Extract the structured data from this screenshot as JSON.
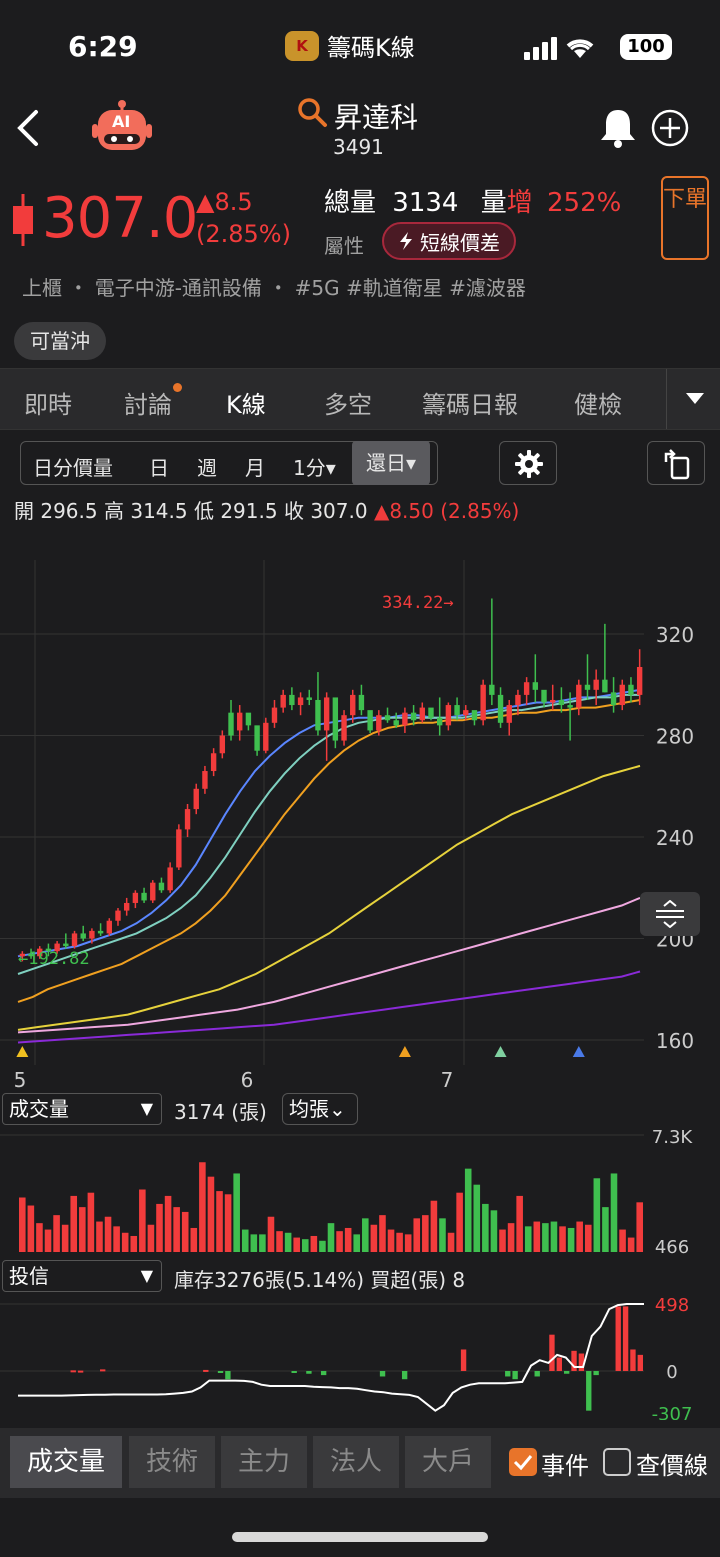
{
  "status": {
    "time": "6:29",
    "app_name": "籌碼K線",
    "app_badge": "K",
    "battery": "100"
  },
  "header": {
    "ai_label": "AI",
    "stock_name": "昇達科",
    "stock_code": "3491"
  },
  "quote": {
    "price": "307.0",
    "change": "▲8.5",
    "change_pct": "(2.85%)",
    "volume_label": "總量",
    "volume": "3134",
    "ratio_label": "量",
    "ratio_word": "增",
    "ratio": "252%",
    "attr_label": "屬性",
    "attr_tag": "短線價差",
    "order_btn": "下單",
    "industry": "上櫃 ・ 電子中游-通訊設備 ・ #5G  #軌道衛星  #濾波器",
    "daytrade": "可當沖"
  },
  "tabs": [
    {
      "label": "即時"
    },
    {
      "label": "討論"
    },
    {
      "label": "K線"
    },
    {
      "label": "多空"
    },
    {
      "label": "籌碼日報"
    },
    {
      "label": "健檢"
    }
  ],
  "periods": [
    {
      "label": "日分價量"
    },
    {
      "label": "日"
    },
    {
      "label": "週"
    },
    {
      "label": "月"
    },
    {
      "label": "1分▾"
    },
    {
      "label": "還日▾"
    }
  ],
  "ohlc": {
    "open_label": "開",
    "open": "296.5",
    "high_label": "高",
    "high": "314.5",
    "low_label": "低",
    "low": "291.5",
    "close_label": "收",
    "close": "307.0",
    "change": "▲8.50 (2.85%)"
  },
  "indicators": {
    "volume_select": "成交量",
    "volume_value": "3174 (張)",
    "avg_select": "均張⌄",
    "inst_select": "投信",
    "inst_info": "庫存3276張(5.14%)   買超(張) 8"
  },
  "bottom_tabs": [
    {
      "label": "成交量"
    },
    {
      "label": "技術"
    },
    {
      "label": "主力"
    },
    {
      "label": "法人"
    },
    {
      "label": "大戶"
    }
  ],
  "options": {
    "events_label": "事件",
    "events_checked": true,
    "price_line_label": "查價線",
    "price_line_checked": false
  },
  "colors": {
    "up": "#f23c3c",
    "down": "#3fbf4f",
    "accent": "#e8742a"
  },
  "chart_data": [
    {
      "type": "candlestick",
      "ylim": [
        160,
        340
      ],
      "y_ticks": [
        "320",
        "280",
        "240",
        "200",
        "160"
      ],
      "x_ticks": [
        "5",
        "6",
        "7"
      ],
      "annotations": {
        "high": "334.22→",
        "low": "←192.82"
      },
      "candles": [
        [
          193,
          195,
          191,
          194
        ],
        [
          194,
          196,
          192,
          193
        ],
        [
          193,
          197,
          192,
          196
        ],
        [
          196,
          198,
          193,
          195
        ],
        [
          195,
          199,
          194,
          198
        ],
        [
          198,
          202,
          196,
          197
        ],
        [
          197,
          203,
          196,
          202
        ],
        [
          202,
          205,
          199,
          200
        ],
        [
          200,
          204,
          198,
          203
        ],
        [
          203,
          206,
          201,
          202
        ],
        [
          202,
          208,
          201,
          207
        ],
        [
          207,
          212,
          205,
          211
        ],
        [
          211,
          216,
          209,
          214
        ],
        [
          214,
          219,
          212,
          218
        ],
        [
          218,
          220,
          214,
          215
        ],
        [
          215,
          223,
          214,
          222
        ],
        [
          222,
          224,
          218,
          219
        ],
        [
          219,
          230,
          218,
          228
        ],
        [
          228,
          245,
          227,
          243
        ],
        [
          243,
          253,
          240,
          251
        ],
        [
          251,
          261,
          249,
          259
        ],
        [
          259,
          268,
          257,
          266
        ],
        [
          266,
          275,
          264,
          273
        ],
        [
          273,
          282,
          271,
          280
        ],
        [
          289,
          294,
          278,
          280
        ],
        [
          282,
          292,
          278,
          289
        ],
        [
          289,
          286,
          282,
          284
        ],
        [
          284,
          276,
          272,
          274
        ],
        [
          274,
          287,
          273,
          285
        ],
        [
          285,
          294,
          283,
          291
        ],
        [
          291,
          298,
          289,
          296
        ],
        [
          296,
          299,
          290,
          292
        ],
        [
          292,
          297,
          288,
          295
        ],
        [
          295,
          298,
          292,
          294
        ],
        [
          294,
          305,
          280,
          282
        ],
        [
          282,
          297,
          270,
          295
        ],
        [
          295,
          286,
          275,
          278
        ],
        [
          278,
          290,
          276,
          288
        ],
        [
          288,
          298,
          285,
          296
        ],
        [
          296,
          300,
          288,
          290
        ],
        [
          290,
          283,
          281,
          282
        ],
        [
          282,
          290,
          280,
          288
        ],
        [
          288,
          291,
          285,
          286
        ],
        [
          286,
          289,
          283,
          284
        ],
        [
          284,
          291,
          281,
          289
        ],
        [
          289,
          292,
          284,
          286
        ],
        [
          286,
          293,
          285,
          291
        ],
        [
          291,
          288,
          286,
          287
        ],
        [
          287,
          295,
          280,
          284
        ],
        [
          284,
          293,
          282,
          292
        ],
        [
          292,
          295,
          286,
          288
        ],
        [
          288,
          292,
          286,
          290
        ],
        [
          290,
          288,
          284,
          286
        ],
        [
          286,
          302,
          284,
          300
        ],
        [
          300,
          334,
          292,
          296
        ],
        [
          296,
          299,
          283,
          285
        ],
        [
          285,
          294,
          280,
          292
        ],
        [
          292,
          298,
          288,
          296
        ],
        [
          296,
          303,
          292,
          301
        ],
        [
          301,
          312,
          293,
          298
        ],
        [
          298,
          297,
          291,
          293
        ],
        [
          293,
          300,
          290,
          294
        ],
        [
          294,
          299,
          289,
          292
        ],
        [
          292,
          297,
          278,
          291
        ],
        [
          291,
          302,
          288,
          300
        ],
        [
          300,
          312,
          294,
          298
        ],
        [
          298,
          306,
          292,
          302
        ],
        [
          302,
          324,
          297,
          297
        ],
        [
          297,
          303,
          289,
          292
        ],
        [
          292,
          302,
          290,
          300
        ],
        [
          300,
          303,
          293,
          296
        ],
        [
          296,
          314,
          292,
          307
        ]
      ],
      "ma_series": [
        {
          "color": "#5a86ff",
          "values": [
            193,
            194,
            195,
            196,
            197,
            199,
            201,
            203,
            206,
            210,
            215,
            221,
            229,
            239,
            249,
            258,
            266,
            272,
            277,
            281,
            284,
            285,
            286,
            287,
            287,
            287,
            288,
            288,
            287,
            287,
            288,
            289,
            290,
            291,
            292,
            293,
            293,
            294,
            295,
            295,
            296,
            297,
            298
          ]
        },
        {
          "color": "#7fd0c0",
          "values": [
            186,
            188,
            190,
            192,
            194,
            196,
            198,
            200,
            202,
            205,
            208,
            212,
            217,
            224,
            232,
            241,
            250,
            258,
            265,
            271,
            276,
            280,
            283,
            285,
            286,
            287,
            287,
            287,
            287,
            287,
            287,
            288,
            289,
            290,
            290,
            291,
            292,
            293,
            294,
            295,
            295,
            296,
            296
          ]
        },
        {
          "color": "#f0a020",
          "values": [
            175,
            177,
            180,
            182,
            184,
            186,
            188,
            190,
            193,
            196,
            199,
            202,
            206,
            211,
            217,
            225,
            233,
            241,
            249,
            256,
            263,
            269,
            274,
            278,
            281,
            283,
            284,
            285,
            285,
            286,
            286,
            287,
            287,
            288,
            289,
            289,
            290,
            290,
            291,
            291,
            292,
            293,
            294
          ]
        },
        {
          "color": "#e6d23c",
          "values": [
            164,
            165,
            166,
            167,
            168,
            169,
            170,
            172,
            174,
            176,
            178,
            180,
            183,
            186,
            190,
            194,
            198,
            202,
            207,
            212,
            217,
            222,
            227,
            232,
            237,
            241,
            245,
            249,
            252,
            255,
            258,
            261,
            264,
            266,
            268
          ]
        },
        {
          "color": "#f0a8e0",
          "values": [
            163,
            163.5,
            164,
            164.5,
            165,
            165.5,
            166,
            167,
            168,
            169,
            170,
            171,
            172,
            173.5,
            175,
            177,
            179,
            181,
            183,
            185,
            187,
            189,
            191,
            193,
            195,
            197,
            199,
            201,
            203,
            205,
            207,
            209,
            211,
            213,
            216
          ]
        },
        {
          "color": "#8a2ad8",
          "values": [
            159,
            159.5,
            160,
            160.5,
            161,
            161.5,
            162,
            162.5,
            163,
            163.5,
            164,
            164.5,
            165,
            165.5,
            166,
            167,
            168,
            169,
            170,
            171,
            172,
            173,
            174,
            175,
            176,
            177,
            178,
            179,
            180,
            181,
            182,
            183,
            184,
            185,
            187
          ]
        }
      ],
      "event_markers": [
        {
          "i": 0,
          "color": "#f0c020"
        },
        {
          "i": 44,
          "color": "#f0a020"
        },
        {
          "i": 55,
          "color": "#7fd0a0"
        },
        {
          "i": 64,
          "color": "#4a7ae8"
        }
      ]
    },
    {
      "type": "bar",
      "title": "成交量",
      "y_ticks": [
        "7.3K",
        "466"
      ],
      "ylim": [
        466,
        7300
      ],
      "values": [
        3400,
        2900,
        1800,
        1400,
        2300,
        1700,
        3500,
        2800,
        3700,
        1900,
        2200,
        1600,
        1200,
        1000,
        3900,
        1700,
        3000,
        3500,
        2800,
        2500,
        1500,
        5600,
        4700,
        3800,
        3600,
        4900,
        1400,
        1100,
        1100,
        2200,
        1300,
        1200,
        900,
        800,
        1000,
        700,
        1800,
        1300,
        1500,
        1100,
        2100,
        1700,
        2300,
        1400,
        1200,
        1100,
        2100,
        2300,
        3200,
        2100,
        1200,
        3700,
        5200,
        4200,
        3000,
        2600,
        1400,
        1800,
        3500,
        1600,
        1900,
        1800,
        1900,
        1600,
        1500,
        1900,
        1700,
        4600,
        2800,
        4900,
        1400,
        900,
        3100
      ],
      "up": [
        1,
        1,
        1,
        1,
        1,
        1,
        1,
        1,
        1,
        1,
        1,
        1,
        1,
        1,
        1,
        1,
        1,
        1,
        1,
        1,
        1,
        1,
        1,
        1,
        1,
        0,
        0,
        0,
        0,
        1,
        1,
        0,
        1,
        0,
        1,
        0,
        0,
        1,
        1,
        0,
        0,
        1,
        1,
        1,
        1,
        1,
        1,
        1,
        1,
        0,
        1,
        1,
        0,
        0,
        0,
        0,
        1,
        1,
        1,
        0,
        1,
        0,
        0,
        1,
        0,
        1,
        1,
        0,
        0,
        0,
        1,
        1,
        1
      ]
    },
    {
      "type": "bar",
      "title": "投信",
      "y_ticks": [
        "498",
        "0",
        "-307"
      ],
      "ylim": [
        -307,
        498
      ],
      "values": [
        0,
        0,
        0,
        0,
        0,
        0,
        0,
        5,
        3,
        0,
        0,
        12,
        0,
        0,
        0,
        0,
        0,
        0,
        0,
        0,
        0,
        0,
        0,
        0,
        0,
        8,
        0,
        -10,
        -60,
        0,
        0,
        0,
        0,
        0,
        0,
        0,
        0,
        -5,
        0,
        -20,
        0,
        -30,
        0,
        0,
        0,
        0,
        0,
        0,
        0,
        -40,
        0,
        0,
        -60,
        0,
        0,
        0,
        0,
        0,
        0,
        0,
        160,
        0,
        0,
        0,
        0,
        0,
        -40,
        -60,
        0,
        0,
        -40,
        0,
        270,
        100,
        -20,
        150,
        130,
        -290,
        -30,
        0,
        0,
        480,
        480,
        160,
        120
      ],
      "line": [
        -180,
        -180,
        -180,
        -180,
        -180,
        -180,
        -178,
        -176,
        -175,
        -174,
        -173,
        -172,
        -172,
        -172,
        -172,
        -172,
        -172,
        -170,
        -165,
        -160,
        -150,
        -120,
        -70,
        -70,
        -70,
        -70,
        -72,
        -80,
        -100,
        -110,
        -110,
        -110,
        -110,
        -110,
        -115,
        -118,
        -120,
        -125,
        -125,
        -130,
        -140,
        -150,
        -155,
        -165,
        -170,
        -175,
        -190,
        -240,
        -290,
        -250,
        -160,
        -120,
        -100,
        -90,
        -90,
        -90,
        -90,
        -85,
        -80,
        40,
        80,
        60,
        120,
        100,
        30,
        30,
        260,
        330,
        460,
        490,
        498,
        498,
        498
      ]
    }
  ]
}
